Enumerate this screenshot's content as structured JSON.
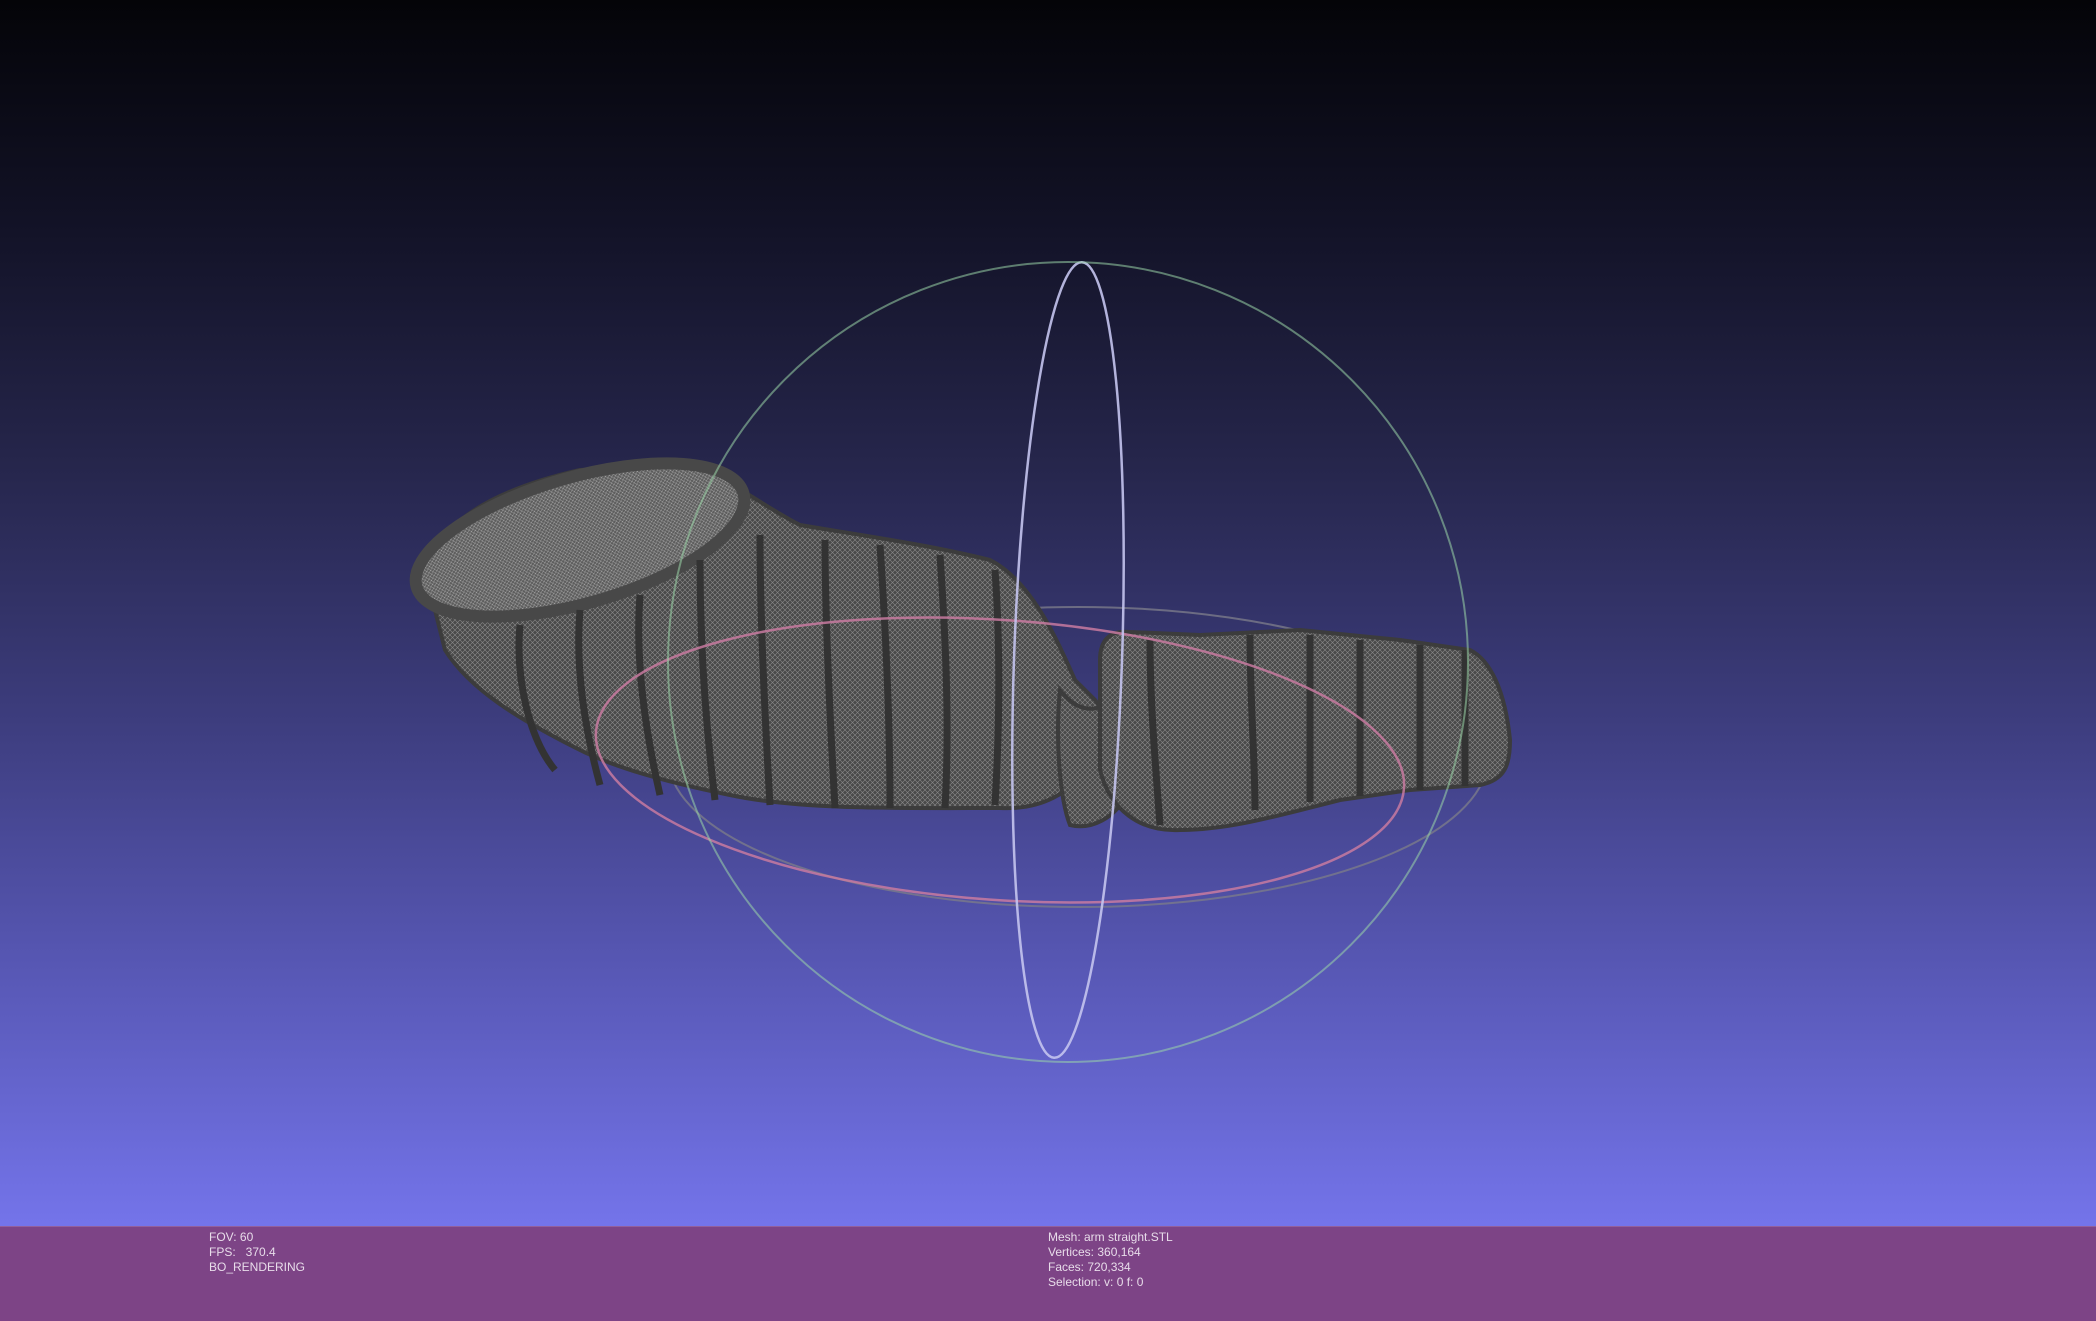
{
  "viewport": {
    "background_top": "#040408",
    "background_bottom": "#7474ea",
    "mesh_color": "#555555",
    "trackball": {
      "horizontal_ring_color": "#c87aa0",
      "vertical_ring_color": "#c4c4ee",
      "front_ring_color": "#9ad6a8"
    }
  },
  "info": {
    "left": {
      "fov": "FOV: 60",
      "fps": "FPS:   370.4",
      "mode": "BO_RENDERING"
    },
    "right": {
      "mesh": "Mesh: arm straight.STL",
      "vertices": "Vertices: 360,164",
      "faces": "Faces: 720,334",
      "selection": "Selection: v: 0 f: 0"
    }
  },
  "info_bar_color": "#7d4486"
}
